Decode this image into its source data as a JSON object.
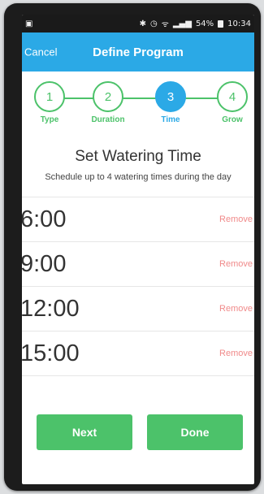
{
  "status_bar": {
    "battery": "54%",
    "time": "10:34"
  },
  "header": {
    "cancel_label": "Cancel",
    "title": "Define Program"
  },
  "steps": [
    {
      "number": "1",
      "label": "Type",
      "active": false
    },
    {
      "number": "2",
      "label": "Duration",
      "active": false
    },
    {
      "number": "3",
      "label": "Time",
      "active": true
    },
    {
      "number": "4",
      "label": "Grow",
      "active": false
    }
  ],
  "section": {
    "title": "Set Watering Time",
    "subtitle": "Schedule up to 4 watering times during the day"
  },
  "times": [
    {
      "value": "6:00",
      "remove_label": "Remove"
    },
    {
      "value": "9:00",
      "remove_label": "Remove"
    },
    {
      "value": "12:00",
      "remove_label": "Remove"
    },
    {
      "value": "15:00",
      "remove_label": "Remove"
    }
  ],
  "buttons": {
    "next_label": "Next",
    "done_label": "Done"
  },
  "colors": {
    "header": "#2ba9e6",
    "accent_green": "#4cc26a",
    "remove_red": "#f08a8a"
  }
}
